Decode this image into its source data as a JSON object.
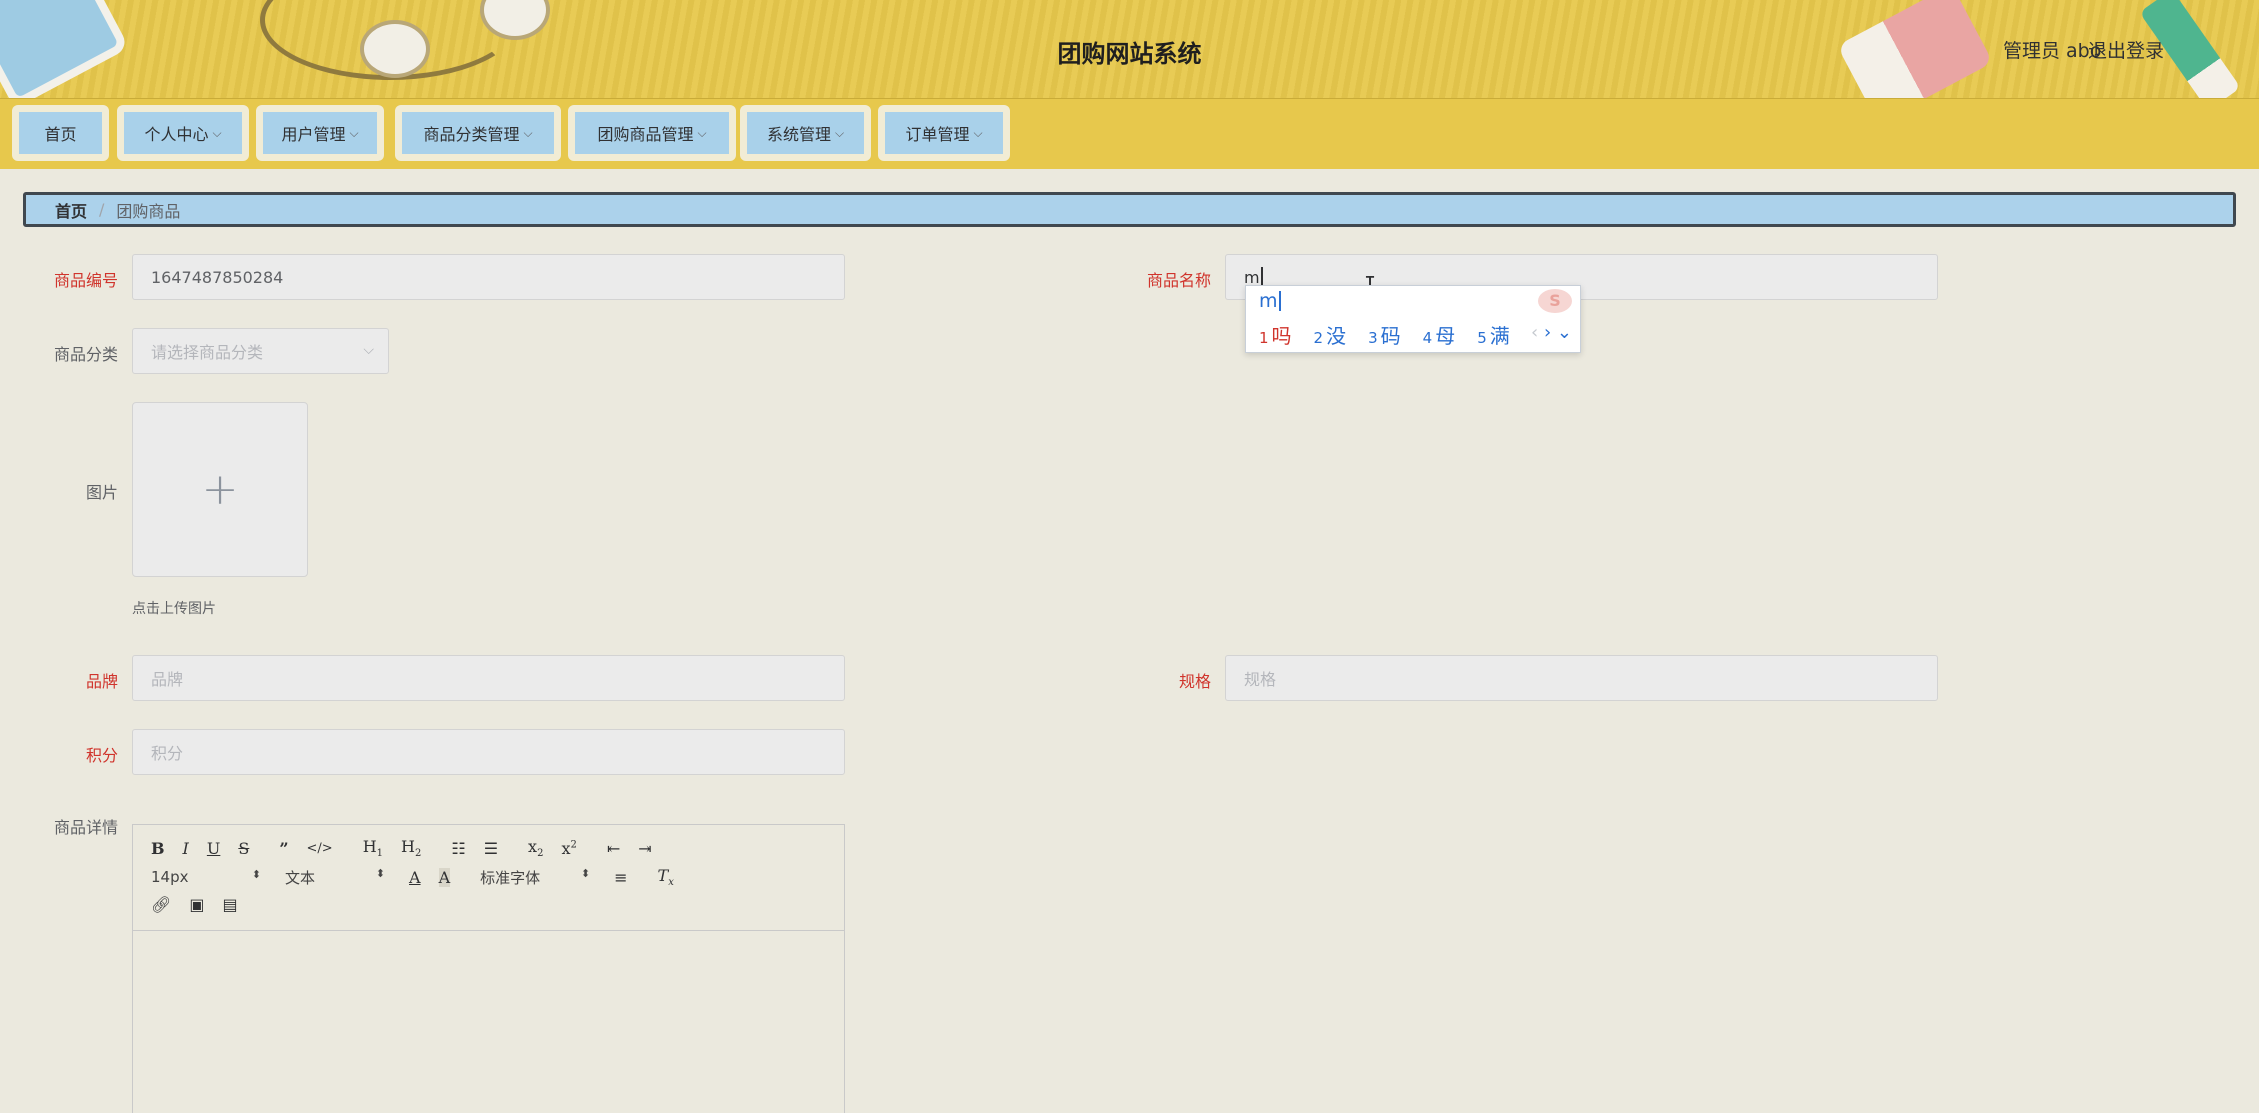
{
  "header": {
    "title": "团购网站系统",
    "user": "管理员 abo",
    "logout": "退出登录"
  },
  "nav": [
    {
      "label": "首页",
      "dropdown": false
    },
    {
      "label": "个人中心",
      "dropdown": true
    },
    {
      "label": "用户管理",
      "dropdown": true
    },
    {
      "label": "商品分类管理",
      "dropdown": true
    },
    {
      "label": "团购商品管理",
      "dropdown": true
    },
    {
      "label": "系统管理",
      "dropdown": true
    },
    {
      "label": "订单管理",
      "dropdown": true
    }
  ],
  "breadcrumb": {
    "home": "首页",
    "separator": "/",
    "current": "团购商品"
  },
  "form": {
    "product_no": {
      "label": "商品编号",
      "value": "1647487850284"
    },
    "product_name": {
      "label": "商品名称",
      "value": "m"
    },
    "category": {
      "label": "商品分类",
      "placeholder": "请选择商品分类"
    },
    "image": {
      "label": "图片",
      "tip": "点击上传图片"
    },
    "brand": {
      "label": "品牌",
      "placeholder": "品牌"
    },
    "spec": {
      "label": "规格",
      "placeholder": "规格"
    },
    "points": {
      "label": "积分",
      "placeholder": "积分"
    },
    "detail": {
      "label": "商品详情"
    }
  },
  "ime": {
    "input": "m",
    "candidates": [
      {
        "n": "1",
        "text": "吗"
      },
      {
        "n": "2",
        "text": "没"
      },
      {
        "n": "3",
        "text": "码"
      },
      {
        "n": "4",
        "text": "母"
      },
      {
        "n": "5",
        "text": "满"
      }
    ]
  },
  "editor": {
    "font_size": "14px",
    "block_type": "文本",
    "font_family": "标准字体"
  },
  "colors": {
    "header_bg": "#e7c84c",
    "nav_button": "#a9d1ea",
    "breadcrumb_bg": "#acd2eb",
    "required_label": "#d0342c",
    "page_bg": "#ebe9de"
  }
}
